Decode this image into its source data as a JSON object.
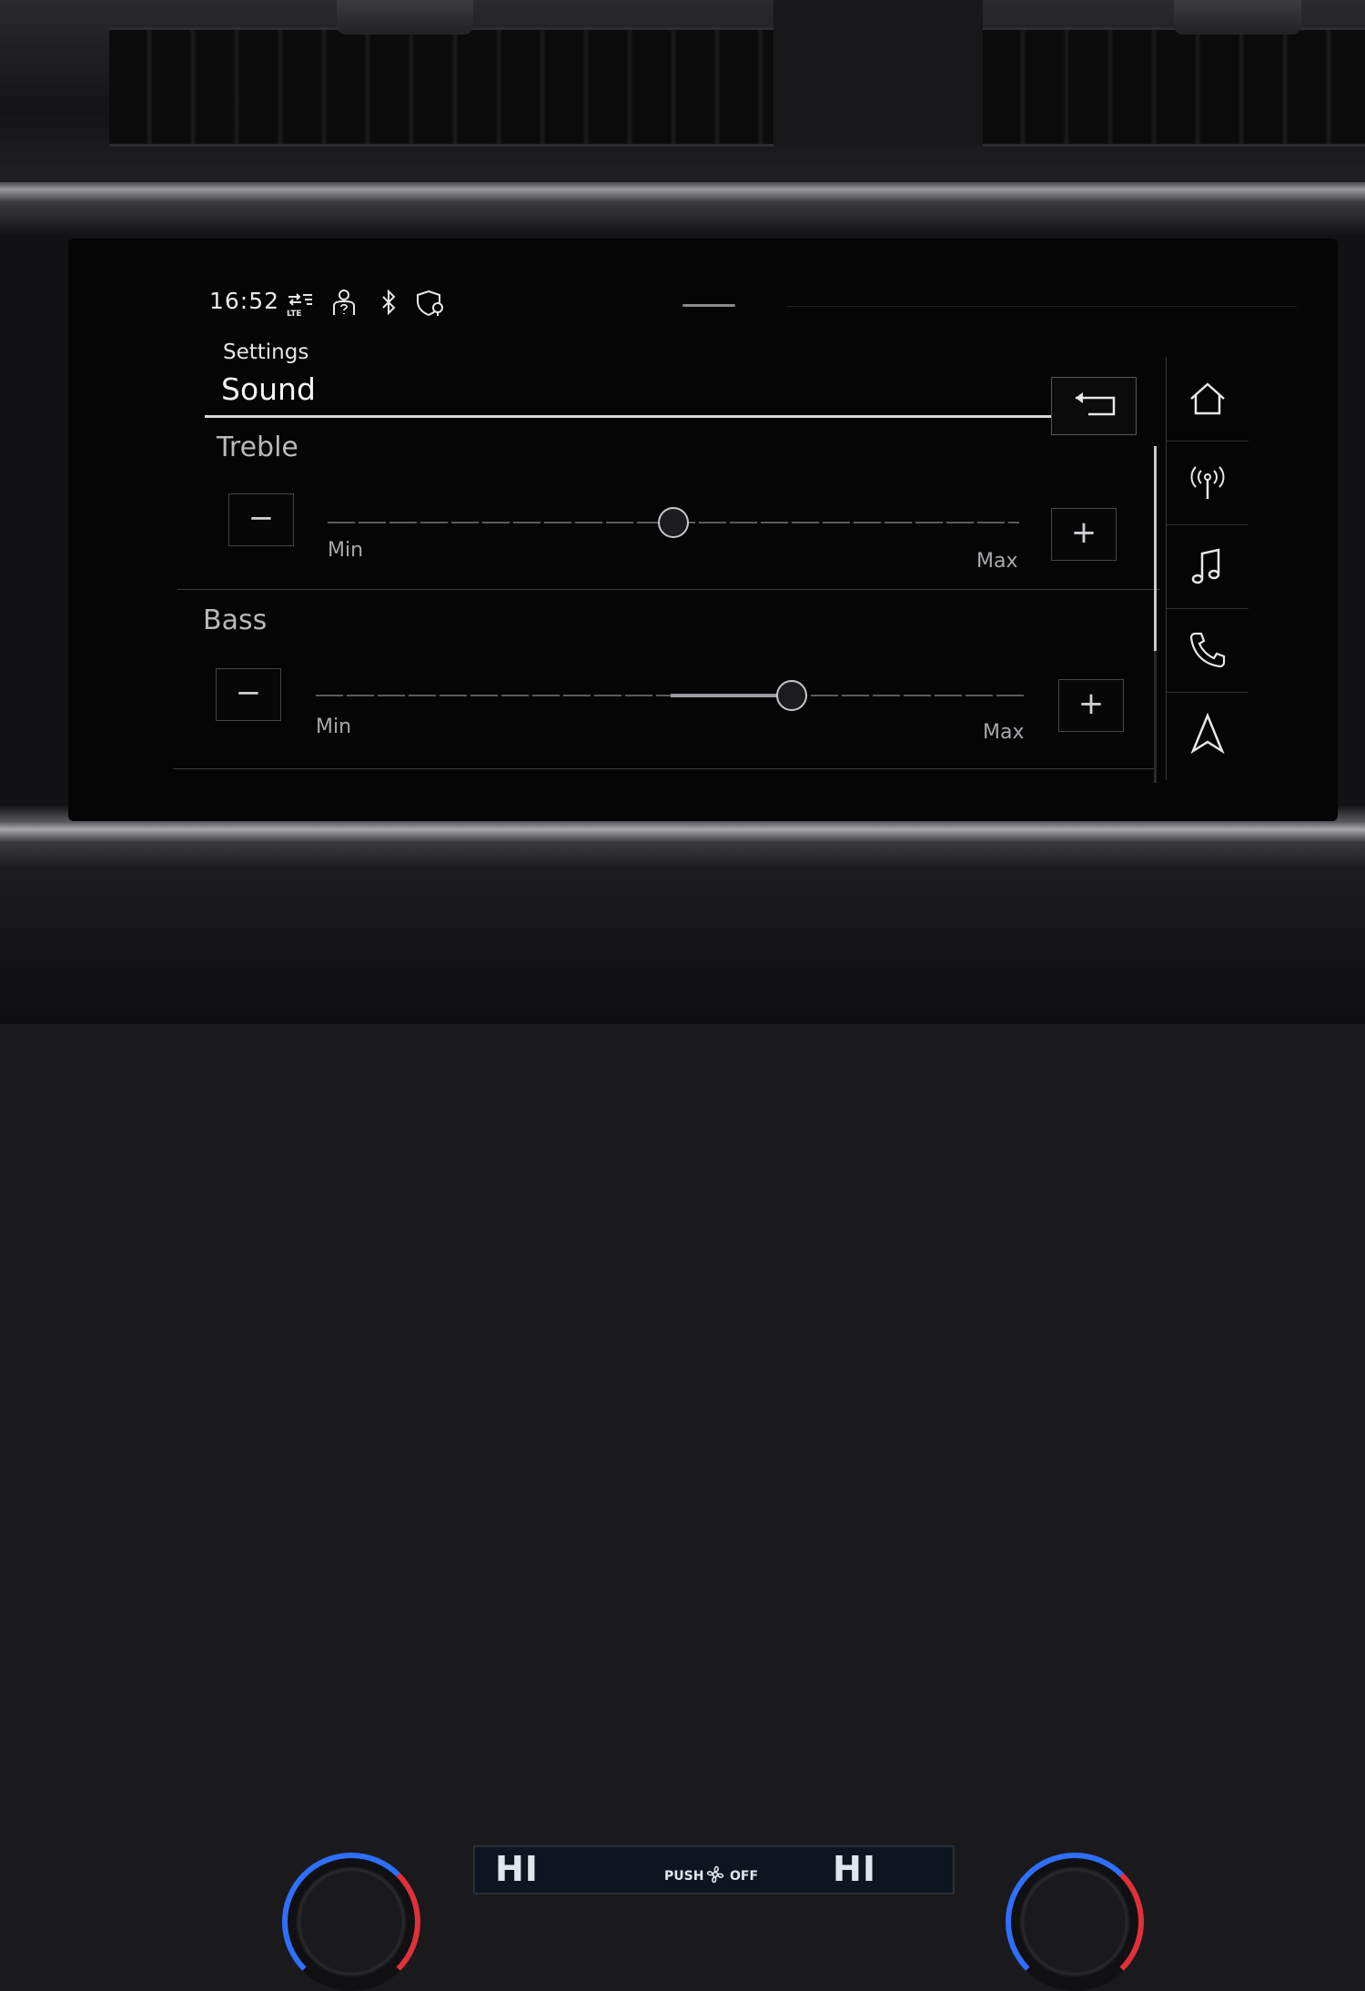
{
  "status_bar": {
    "time": "16:52",
    "icons": [
      "lte-data-icon",
      "user-profile-icon",
      "bluetooth-icon",
      "shield-location-icon"
    ],
    "lte_label": "LTE"
  },
  "header": {
    "breadcrumb": "Settings",
    "title": "Sound",
    "back_icon": "back-arrow-icon"
  },
  "treble": {
    "label": "Treble",
    "min_label": "Min",
    "max_label": "Max",
    "minus": "−",
    "plus": "+",
    "level": 0.5
  },
  "bass": {
    "label": "Bass",
    "min_label": "Min",
    "max_label": "Max",
    "minus": "−",
    "plus": "+",
    "level": 0.67
  },
  "side_nav": {
    "items": [
      {
        "name": "home",
        "icon": "home-icon"
      },
      {
        "name": "radio",
        "icon": "radio-antenna-icon"
      },
      {
        "name": "media",
        "icon": "music-note-icon"
      },
      {
        "name": "phone",
        "icon": "phone-icon"
      },
      {
        "name": "navigation",
        "icon": "navigation-arrow-icon"
      }
    ]
  },
  "climate": {
    "left_temp": "HI",
    "right_temp": "HI",
    "push_label": "PUSH",
    "off_label": "OFF"
  },
  "colors": {
    "screen_bg": "#050506",
    "text": "#e8e8ea",
    "muted": "#b9b9bc",
    "knob_blue": "#2f6fff",
    "knob_red": "#e0303a"
  }
}
